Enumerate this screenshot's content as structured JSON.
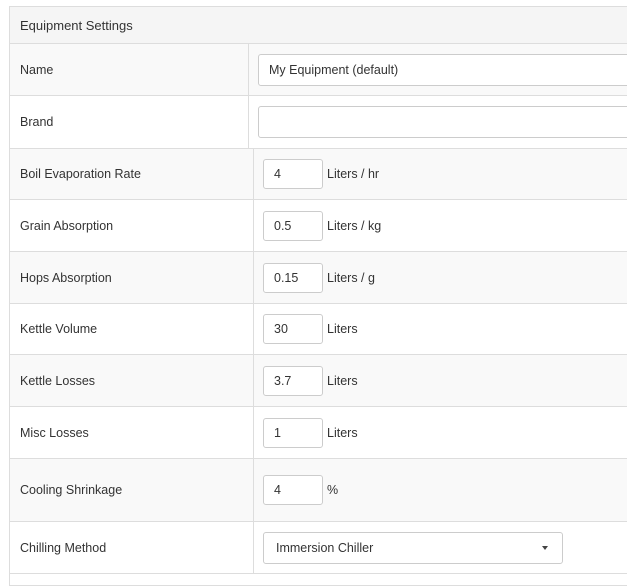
{
  "panel": {
    "title": "Equipment Settings"
  },
  "fields": {
    "name": {
      "label": "Name",
      "value": "My Equipment (default)"
    },
    "brand": {
      "label": "Brand",
      "value": ""
    },
    "boil_evaporation_rate": {
      "label": "Boil Evaporation Rate",
      "value": "4",
      "unit": "Liters / hr"
    },
    "grain_absorption": {
      "label": "Grain Absorption",
      "value": "0.5",
      "unit": "Liters / kg"
    },
    "hops_absorption": {
      "label": "Hops Absorption",
      "value": "0.15",
      "unit": "Liters / g"
    },
    "kettle_volume": {
      "label": "Kettle Volume",
      "value": "30",
      "unit": "Liters"
    },
    "kettle_losses": {
      "label": "Kettle Losses",
      "value": "3.7",
      "unit": "Liters"
    },
    "misc_losses": {
      "label": "Misc Losses",
      "value": "1",
      "unit": "Liters"
    },
    "cooling_shrinkage": {
      "label": "Cooling Shrinkage",
      "value": "4",
      "unit": "%"
    },
    "chilling_method": {
      "label": "Chilling Method",
      "selected": "Immersion Chiller",
      "icon": "chevron-down-icon"
    }
  }
}
